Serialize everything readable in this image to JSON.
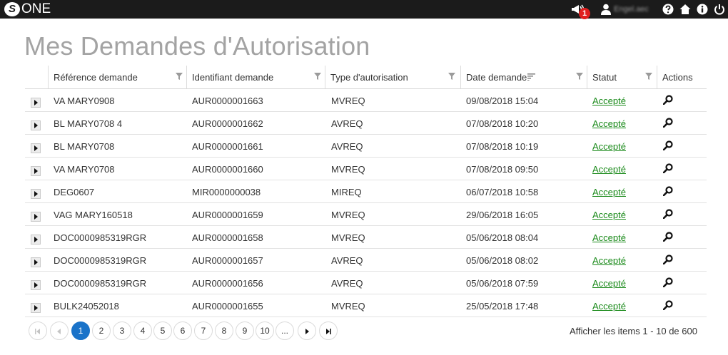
{
  "app": {
    "logo_letter": "S",
    "logo_name": "ONE",
    "notification_count": "1",
    "username": "Engel.aec"
  },
  "page": {
    "title": "Mes Demandes d'Autorisation"
  },
  "table": {
    "columns": [
      {
        "label": "Référence demande",
        "filterable": true
      },
      {
        "label": "Identifiant demande",
        "filterable": true
      },
      {
        "label": "Type d'autorisation",
        "filterable": true
      },
      {
        "label": "Date demande",
        "filterable": true,
        "sorted": true
      },
      {
        "label": "Statut",
        "filterable": true
      },
      {
        "label": "Actions",
        "filterable": false
      }
    ],
    "rows": [
      {
        "ref": "VA MARY0908",
        "id": "AUR0000001663",
        "type": "MVREQ",
        "date": "09/08/2018 15:04",
        "status": "Accepté"
      },
      {
        "ref": "BL MARY0708 4",
        "id": "AUR0000001662",
        "type": "AVREQ",
        "date": "07/08/2018 10:20",
        "status": "Accepté"
      },
      {
        "ref": "BL MARY0708",
        "id": "AUR0000001661",
        "type": "AVREQ",
        "date": "07/08/2018 10:19",
        "status": "Accepté"
      },
      {
        "ref": "VA MARY0708",
        "id": "AUR0000001660",
        "type": "MVREQ",
        "date": "07/08/2018 09:50",
        "status": "Accepté"
      },
      {
        "ref": "DEG0607",
        "id": "MIR0000000038",
        "type": "MIREQ",
        "date": "06/07/2018 10:58",
        "status": "Accepté"
      },
      {
        "ref": "VAG MARY160518",
        "id": "AUR0000001659",
        "type": "MVREQ",
        "date": "29/06/2018 16:05",
        "status": "Accepté"
      },
      {
        "ref": "DOC0000985319RGR",
        "id": "AUR0000001658",
        "type": "MVREQ",
        "date": "05/06/2018 08:04",
        "status": "Accepté"
      },
      {
        "ref": "DOC0000985319RGR",
        "id": "AUR0000001657",
        "type": "AVREQ",
        "date": "05/06/2018 08:02",
        "status": "Accepté"
      },
      {
        "ref": "DOC0000985319RGR",
        "id": "AUR0000001656",
        "type": "AVREQ",
        "date": "05/06/2018 07:59",
        "status": "Accepté"
      },
      {
        "ref": "BULK24052018",
        "id": "AUR0000001655",
        "type": "MVREQ",
        "date": "25/05/2018 17:48",
        "status": "Accepté"
      }
    ]
  },
  "pager": {
    "first_icon": "first-page-icon",
    "prev_icon": "prev-page-icon",
    "pages": [
      "1",
      "2",
      "3",
      "4",
      "5",
      "6",
      "7",
      "8",
      "9",
      "10",
      "..."
    ],
    "current": "1",
    "next_icon": "next-page-icon",
    "last_icon": "last-page-icon",
    "info": "Afficher les items 1 - 10 de 600"
  },
  "colors": {
    "topbar": "#1b1b1b",
    "accent": "#1a73c9",
    "status_link": "#1a8a1a",
    "badge": "#e02020",
    "title": "#a3a3a3"
  }
}
